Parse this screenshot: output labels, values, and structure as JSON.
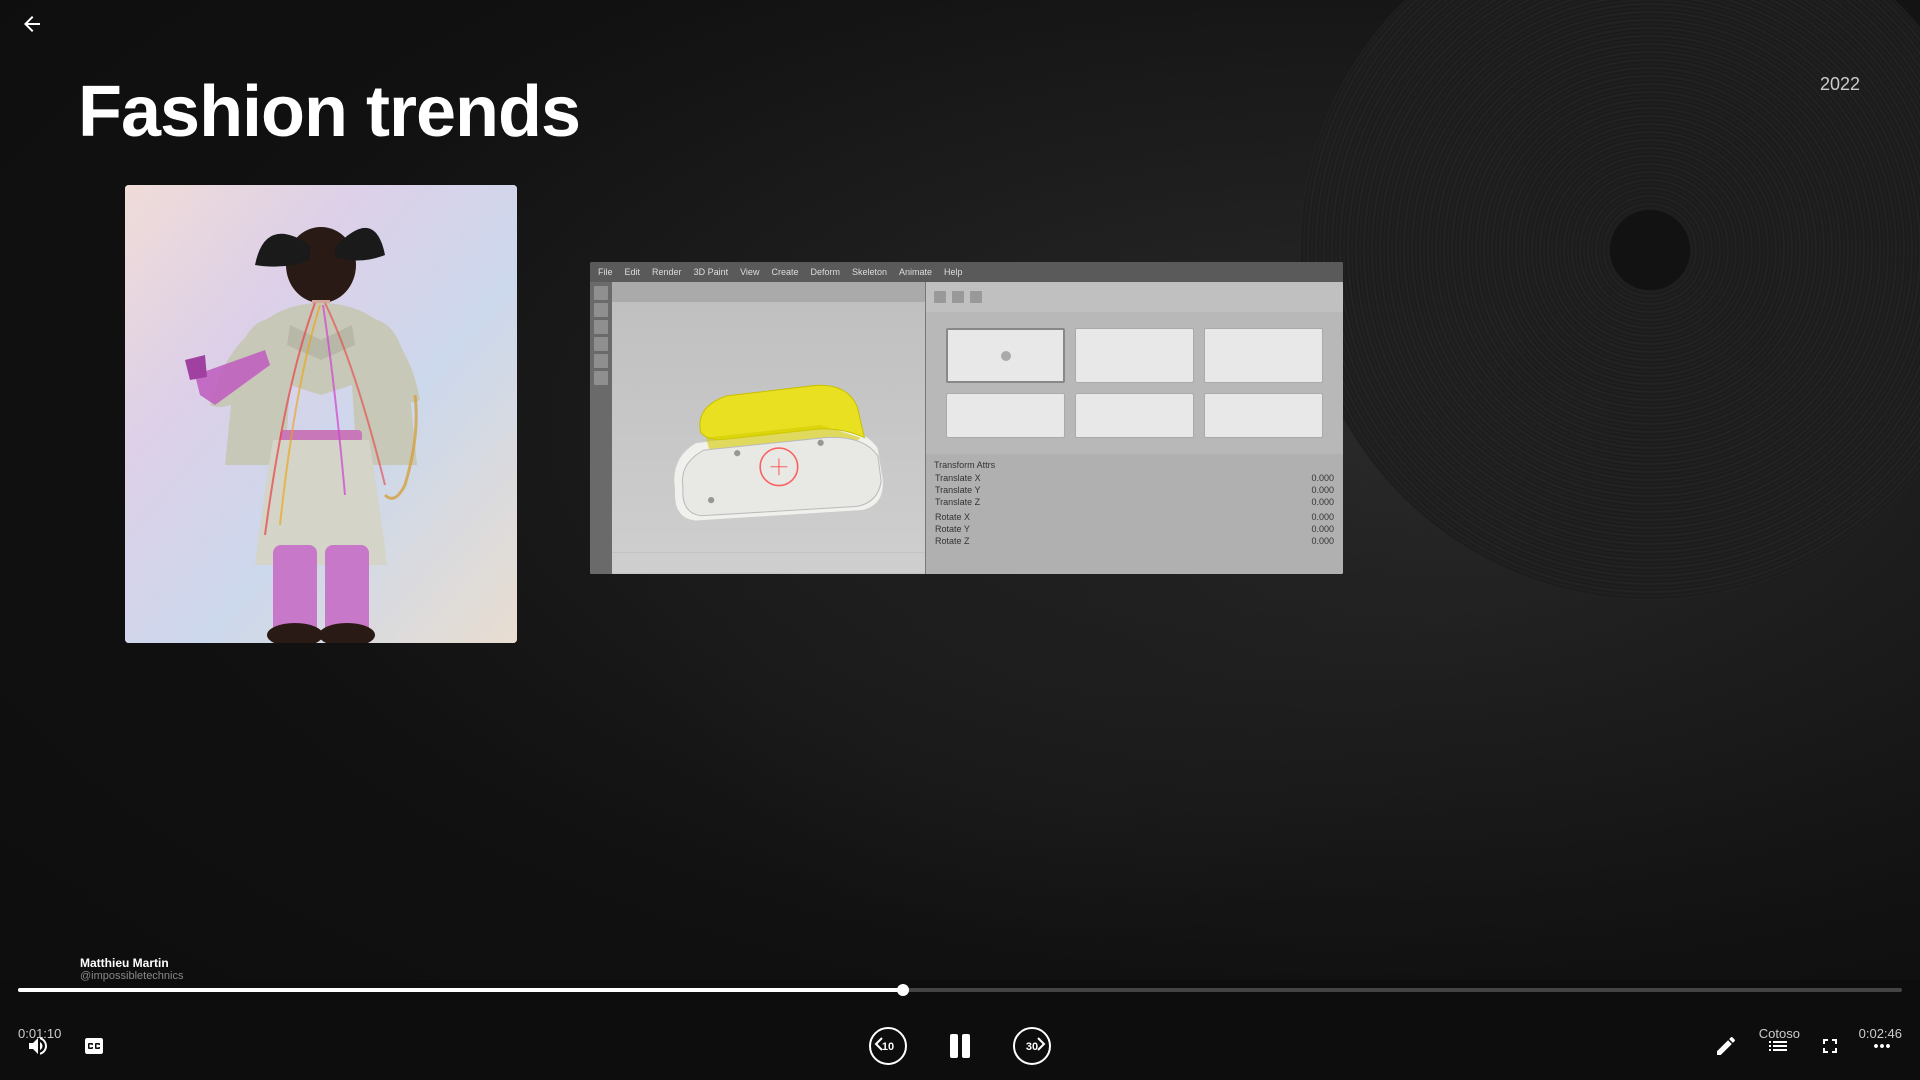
{
  "page": {
    "title": "Fashion trends",
    "year": "2022"
  },
  "navigation": {
    "back_label": "←"
  },
  "uploader": {
    "name": "Matthieu Martin",
    "handle": "@impossibletechnics"
  },
  "player": {
    "time_current": "0:01:10",
    "time_total": "0:02:46",
    "progress_percent": 47,
    "channel": "Cotoso",
    "skip_back_label": "10",
    "skip_forward_label": "30"
  },
  "software": {
    "menu_items": [
      "File",
      "Edit",
      "Render",
      "3D Paint",
      "View",
      "Create",
      "Deform",
      "Skeleton",
      "Animate",
      "Help"
    ],
    "thumbnails": [
      {
        "id": 1,
        "active": true
      },
      {
        "id": 2,
        "active": false
      },
      {
        "id": 3,
        "active": false
      },
      {
        "id": 4,
        "active": false
      },
      {
        "id": 5,
        "active": false
      },
      {
        "id": 6,
        "active": false
      }
    ]
  },
  "icons": {
    "volume": "🔊",
    "captions": "💬",
    "pencil": "✏️",
    "playlist": "▤",
    "fullscreen": "⛶",
    "more": "⋯"
  },
  "colors": {
    "background": "#141414",
    "accent": "#ffffff",
    "progress_fill": "#ffffff",
    "text_primary": "#ffffff",
    "text_secondary": "#888888"
  }
}
